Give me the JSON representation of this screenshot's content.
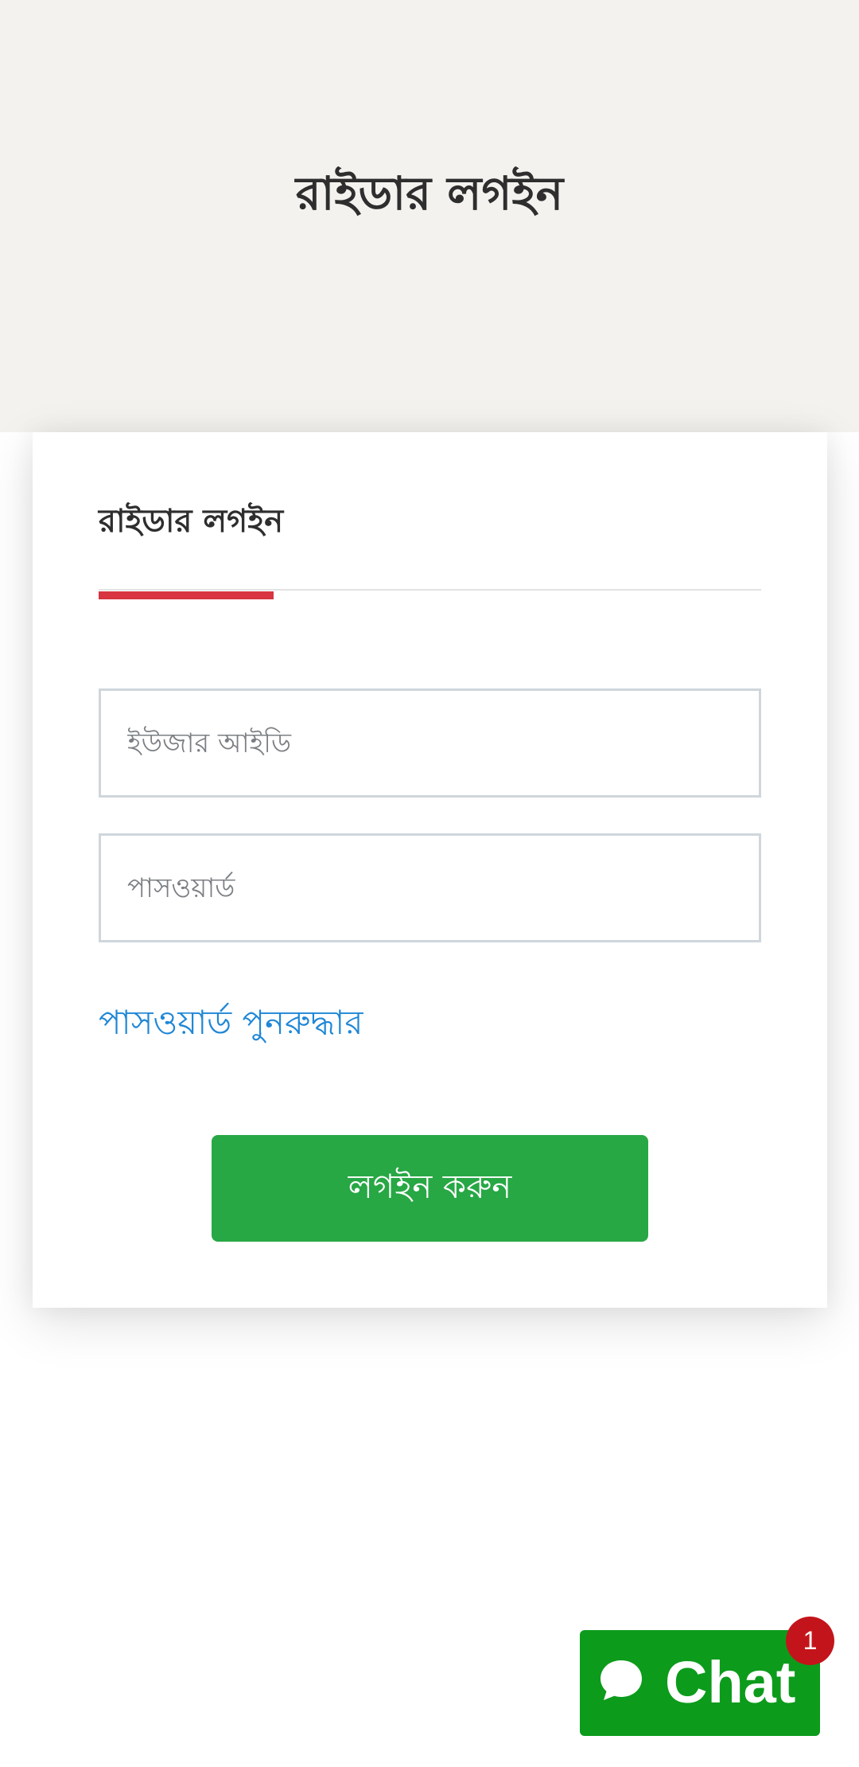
{
  "header": {
    "title": "রাইডার লগইন"
  },
  "login_card": {
    "title": "রাইডার লগইন",
    "accent_color": "#d83442",
    "user_id_field": {
      "value": "",
      "placeholder": "ইউজার আইডি"
    },
    "password_field": {
      "value": "",
      "placeholder": "পাসওয়ার্ড"
    },
    "forgot_password_link": "পাসওয়ার্ড পুনরুদ্ধার",
    "submit_label": "লগইন করুন",
    "submit_color": "#28a745"
  },
  "chat_widget": {
    "icon": "chat-bubble-icon",
    "label": "Chat",
    "unread_count": "1",
    "color": "#0d9b1c",
    "badge_color": "#c4141b"
  }
}
